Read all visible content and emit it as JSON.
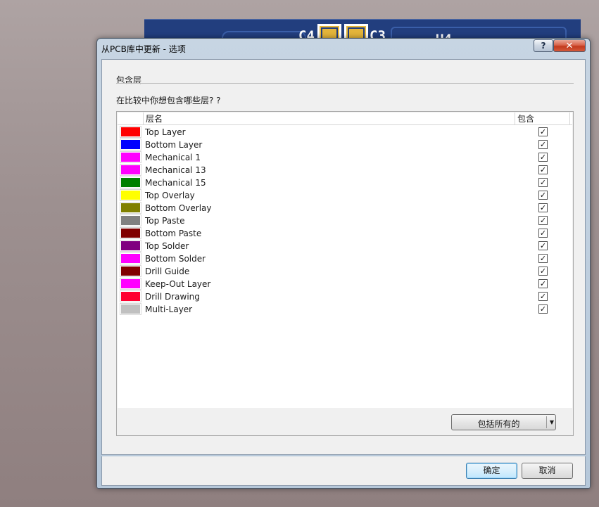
{
  "background": {
    "labels": [
      "C4",
      "C3",
      "U4"
    ]
  },
  "dialog": {
    "title": "从PCB库中更新 - 选项",
    "help_label": "?",
    "close_label": "✕",
    "section_header": "包含层",
    "question": "在比较中你想包含哪些层? ?",
    "table": {
      "col_name": "层名",
      "col_include": "包含",
      "rows": [
        {
          "name": "Top Layer",
          "color": "#ff0000",
          "checked": true
        },
        {
          "name": "Bottom Layer",
          "color": "#0000ff",
          "checked": true
        },
        {
          "name": "Mechanical 1",
          "color": "#ff00ff",
          "checked": true
        },
        {
          "name": "Mechanical 13",
          "color": "#ff00ff",
          "checked": true
        },
        {
          "name": "Mechanical 15",
          "color": "#008000",
          "checked": true
        },
        {
          "name": "Top Overlay",
          "color": "#ffff00",
          "checked": true
        },
        {
          "name": "Bottom Overlay",
          "color": "#808000",
          "checked": true
        },
        {
          "name": "Top Paste",
          "color": "#808080",
          "checked": true
        },
        {
          "name": "Bottom Paste",
          "color": "#800000",
          "checked": true
        },
        {
          "name": "Top Solder",
          "color": "#800080",
          "checked": true
        },
        {
          "name": "Bottom Solder",
          "color": "#ff00ff",
          "checked": true
        },
        {
          "name": "Drill Guide",
          "color": "#800000",
          "checked": true
        },
        {
          "name": "Keep-Out Layer",
          "color": "#ff00ff",
          "checked": true
        },
        {
          "name": "Drill Drawing",
          "color": "#ff0030",
          "checked": true
        },
        {
          "name": "Multi-Layer",
          "color": "#c0c0c0",
          "checked": true
        }
      ]
    },
    "include_all_label": "包括所有的",
    "ok_label": "确定",
    "cancel_label": "取消"
  }
}
